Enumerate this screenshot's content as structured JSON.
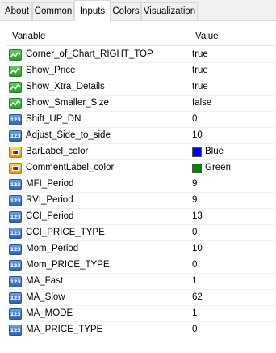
{
  "tabs": [
    {
      "label": "About",
      "active": false
    },
    {
      "label": "Common",
      "active": false
    },
    {
      "label": "Inputs",
      "active": true
    },
    {
      "label": "Colors",
      "active": false
    },
    {
      "label": "Visualization",
      "active": false
    }
  ],
  "table": {
    "headers": {
      "variable": "Variable",
      "value": "Value"
    },
    "rows": [
      {
        "name": "Corner_of_Chart_RIGHT_TOP",
        "value": "true",
        "type": "bool"
      },
      {
        "name": "Show_Price",
        "value": "true",
        "type": "bool"
      },
      {
        "name": "Show_Xtra_Details",
        "value": "true",
        "type": "bool"
      },
      {
        "name": "Show_Smaller_Size",
        "value": "false",
        "type": "bool"
      },
      {
        "name": "Shift_UP_DN",
        "value": "0",
        "type": "num"
      },
      {
        "name": "Adjust_Side_to_side",
        "value": "10",
        "type": "num"
      },
      {
        "name": "BarLabel_color",
        "value": "Blue",
        "type": "color",
        "swatch": "#0000ff"
      },
      {
        "name": "CommentLabel_color",
        "value": "Green",
        "type": "color",
        "swatch": "#008000"
      },
      {
        "name": "MFI_Period",
        "value": "9",
        "type": "num"
      },
      {
        "name": "RVI_Period",
        "value": "9",
        "type": "num"
      },
      {
        "name": "CCI_Period",
        "value": "13",
        "type": "num"
      },
      {
        "name": "CCI_PRICE_TYPE",
        "value": "0",
        "type": "num"
      },
      {
        "name": "Mom_Period",
        "value": "10",
        "type": "num"
      },
      {
        "name": "Mom_PRICE_TYPE",
        "value": "0",
        "type": "num"
      },
      {
        "name": "MA_Fast",
        "value": "1",
        "type": "num"
      },
      {
        "name": "MA_Slow",
        "value": "62",
        "type": "num"
      },
      {
        "name": "MA_MODE",
        "value": "1",
        "type": "num"
      },
      {
        "name": "MA_PRICE_TYPE",
        "value": "0",
        "type": "num"
      }
    ]
  },
  "icons": {
    "bool": "boolean-chart-icon",
    "num": "number-123-icon",
    "color": "color-palette-icon"
  }
}
